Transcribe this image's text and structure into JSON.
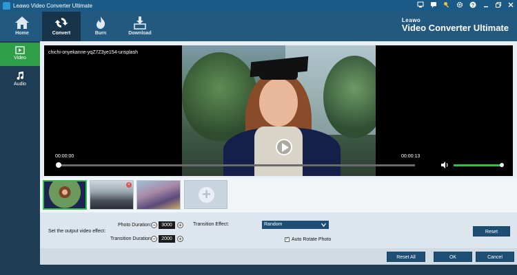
{
  "window": {
    "title": "Leawo Video Converter Ultimate",
    "controls": [
      "cart-icon",
      "chat-icon",
      "key-icon",
      "gear-icon",
      "help-icon",
      "minimize-icon",
      "restore-icon",
      "close-icon"
    ]
  },
  "toolbar": {
    "tabs": [
      {
        "label": "Home",
        "icon": "home-icon"
      },
      {
        "label": "Convert",
        "icon": "convert-icon",
        "active": true
      },
      {
        "label": "Burn",
        "icon": "burn-icon"
      },
      {
        "label": "Download",
        "icon": "download-icon"
      }
    ],
    "brand_top": "Leawo",
    "brand_bottom": "Video Converter Ultimate"
  },
  "sidebar": {
    "items": [
      {
        "label": "Video",
        "icon": "film-icon",
        "active": true
      },
      {
        "label": "Audio",
        "icon": "music-note-icon"
      }
    ]
  },
  "player": {
    "clip_name": "chichi-onyekanne-yqZ7Z3ye154-unsplash",
    "time_current": "00:00:00",
    "time_total": "00:00:13",
    "progress": 0,
    "volume": 1.0
  },
  "thumbnails": {
    "count": 3,
    "active_index": 0
  },
  "settings": {
    "section_label": "Set the output video effect:",
    "photo_duration_label": "Photo Duration:",
    "photo_duration_value": "3000",
    "transition_duration_label": "Transition Duration:",
    "transition_duration_value": "2000",
    "transition_effect_label": "Transition Effect:",
    "transition_effect_value": "Random",
    "auto_rotate_label": "Auto Rotate Photo",
    "auto_rotate_checked": true,
    "reset_label": "Reset"
  },
  "footer": {
    "reset_all_label": "Reset All",
    "ok_label": "OK",
    "cancel_label": "Cancel"
  },
  "colors": {
    "titlebar": "#1b5a86",
    "toolbar": "#23597f",
    "sidebar": "#1e3c53",
    "active_green": "#2f9e48",
    "button": "#1d4e73"
  }
}
